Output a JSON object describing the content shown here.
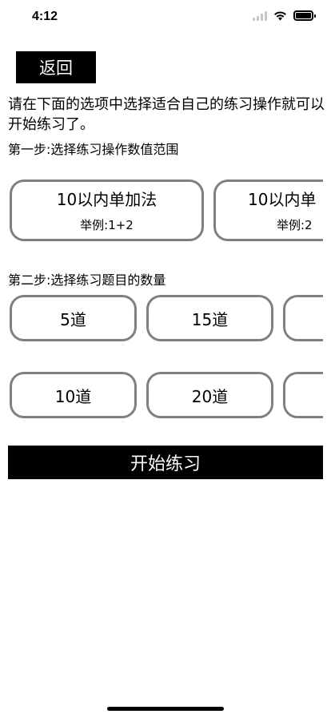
{
  "status_bar": {
    "time": "4:12"
  },
  "back_label": "返回",
  "intro_text": "请在下面的选项中选择适合自己的练习操作就可以开始练习了。",
  "step1_label": "第一步:选择练习操作数值范围",
  "range_options": [
    {
      "title": "10以内单加法",
      "example": "举例:1+2"
    },
    {
      "title": "10以内单",
      "example": "举例:2"
    }
  ],
  "step2_label": "第二步:选择练习题目的数量",
  "count_rows": [
    [
      "5道",
      "15道",
      ""
    ],
    [
      "10道",
      "20道",
      ""
    ]
  ],
  "start_label": "开始练习"
}
